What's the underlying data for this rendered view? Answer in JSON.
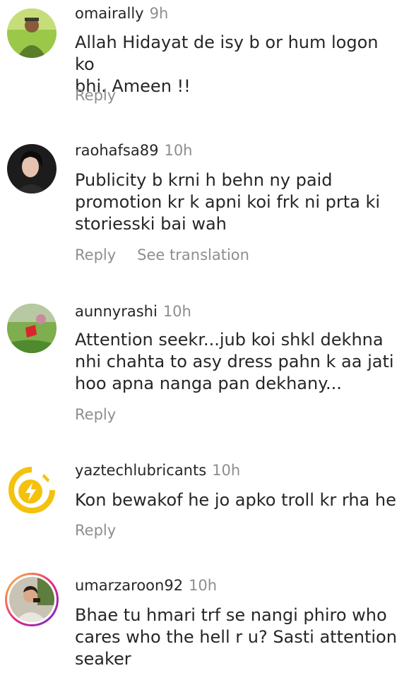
{
  "comments": [
    {
      "username": "omairally",
      "time": "9h",
      "lines": [
        "Allah Hidayat de isy b or hum logon ko",
        "bhi. Ameen !!"
      ],
      "reply_label": "Reply"
    },
    {
      "username": "raohafsa89",
      "time": "10h",
      "lines": [
        "Publicity b krni h behn ny paid",
        "promotion kr k apni koi frk ni prta ki",
        "storiesski bai wah"
      ],
      "reply_label": "Reply",
      "translate_label": "See translation"
    },
    {
      "username": "aunnyrashi",
      "time": "10h",
      "lines": [
        "Attention seekr...jub koi shkl dekhna",
        "nhi chahta to asy dress pahn k aa jati",
        "hoo apna nanga pan dekhany..."
      ],
      "reply_label": "Reply"
    },
    {
      "username": "yaztechlubricants",
      "time": "10h",
      "lines": [
        "Kon bewakof he jo apko troll kr rha he"
      ],
      "reply_label": "Reply"
    },
    {
      "username": "umarzaroon92",
      "time": "10h",
      "lines": [
        "Bhae tu hmari trf se nangi phiro who",
        "cares who the hell r u? Sasti attention",
        "seaker"
      ]
    }
  ],
  "colors": {
    "text": "#262626",
    "secondary": "#8e8e8e",
    "story_ring_start": "#f9ce34",
    "story_ring_end": "#6228d7",
    "brand_yellow": "#f4c20d"
  }
}
